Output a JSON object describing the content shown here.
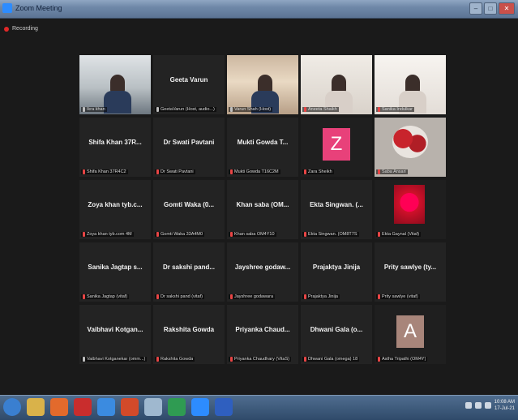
{
  "window": {
    "title": "Zoom Meeting"
  },
  "recording": {
    "label": "Recording"
  },
  "participants": [
    {
      "display": "",
      "label": "Ikra khan",
      "mic": "on",
      "video": "room",
      "active": true
    },
    {
      "display": "Geeta Varun",
      "label": "GeetaVarun (Host, audio...)",
      "mic": "on",
      "video": "none"
    },
    {
      "display": "",
      "label": "Varun Shah (Host)",
      "mic": "on",
      "video": "shelf"
    },
    {
      "display": "",
      "label": "Aneeta Shaikh",
      "mic": "muted",
      "video": "wall"
    },
    {
      "display": "",
      "label": "Sanika Indulkar",
      "mic": "muted",
      "video": "wall2"
    },
    {
      "display": "Shifa Khan 37R...",
      "label": "Shifa Khan 37R4C2",
      "mic": "muted",
      "video": "none"
    },
    {
      "display": "Dr Swati Pavtani",
      "label": "Dr Swati Pavtani",
      "mic": "muted",
      "video": "none"
    },
    {
      "display": "Mukti Gowda T...",
      "label": "Mukti Gowda T16C2M",
      "mic": "muted",
      "video": "none"
    },
    {
      "display": "",
      "label": "Zara Sheikh",
      "mic": "muted",
      "video": "avatar-z",
      "avatar": "Z"
    },
    {
      "display": "",
      "label": "Saba Ansari",
      "mic": "muted",
      "video": "flowers"
    },
    {
      "display": "Zoya khan tyb.c...",
      "label": "Zoya khan tyb.com 4M",
      "mic": "muted",
      "video": "none"
    },
    {
      "display": "Gomti Waka (0...",
      "label": "Gomti Waka 33A4M0",
      "mic": "muted",
      "video": "none"
    },
    {
      "display": "Khan saba (OM...",
      "label": "Khan saba OM4Y10",
      "mic": "muted",
      "video": "none"
    },
    {
      "display": "Ekta Singwan. (...",
      "label": "Ekta Singwan. (OM8T7S",
      "mic": "muted",
      "video": "none"
    },
    {
      "display": "",
      "label": "Ekta Gaynal (Vitaf)",
      "mic": "muted",
      "video": "card"
    },
    {
      "display": "Sanika Jagtap s...",
      "label": "Sanika Jagtap (vitaf)",
      "mic": "muted",
      "video": "none"
    },
    {
      "display": "Dr sakshi pand...",
      "label": "Dr sakshi pand (vitaf)",
      "mic": "muted",
      "video": "none"
    },
    {
      "display": "Jayshree godaw...",
      "label": "Jayshree godawara",
      "mic": "muted",
      "video": "none"
    },
    {
      "display": "Prajaktya Jinija",
      "label": "Prajaktya Jinija",
      "mic": "muted",
      "video": "none"
    },
    {
      "display": "Prity sawlye (ty...",
      "label": "Prity sawlye (vitaf)",
      "mic": "muted",
      "video": "none"
    },
    {
      "display": "Vaibhavi Kotgan...",
      "label": "Vaibhavi Kotganekar (omm...)",
      "mic": "on",
      "video": "none"
    },
    {
      "display": "Rakshita Gowda",
      "label": "Rakshita Gowda",
      "mic": "muted",
      "video": "none"
    },
    {
      "display": "Priyanka Chaud...",
      "label": "Priyanka Chaudhary (VitaS)",
      "mic": "muted",
      "video": "none"
    },
    {
      "display": "Dhwani Gala (o...",
      "label": "Dhwani Gala (omega) 18",
      "mic": "muted",
      "video": "none"
    },
    {
      "display": "",
      "label": "Astha Tripathi (OM4Y)",
      "mic": "muted",
      "video": "avatar-a",
      "avatar": "A"
    }
  ],
  "taskbar": {
    "icons": [
      "start-orb-icon",
      "explorer-icon",
      "firefox-icon",
      "pdf-reader-icon",
      "edge-icon",
      "powerpoint-icon",
      "notepad-icon",
      "excel-icon",
      "zoom-icon",
      "word-icon"
    ],
    "colors": [
      "#3a7fd0",
      "#d9b24a",
      "#e36a2c",
      "#c92d2d",
      "#3b8be0",
      "#d24a2a",
      "#9fb8cf",
      "#2f9b52",
      "#2d8cff",
      "#2f5fbf"
    ],
    "time": "10:08 AM",
    "date": "17-Jul-21"
  }
}
